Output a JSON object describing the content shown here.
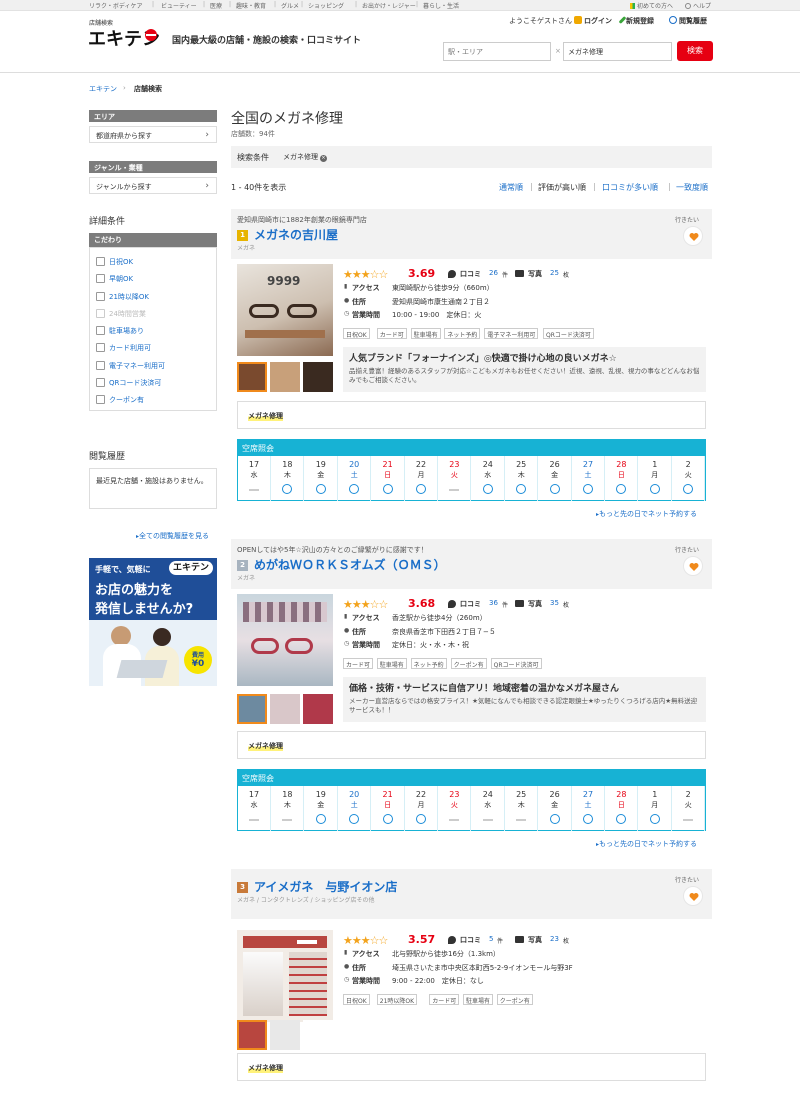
{
  "topbar": {
    "categories": [
      "リラク・ボディケア",
      "ビューティー",
      "医療",
      "趣味・教育",
      "グルメ",
      "ショッピング",
      "お出かけ・レジャー",
      "暮らし・生活"
    ],
    "first_time": "初めての方へ",
    "help": "ヘルプ"
  },
  "header": {
    "logo_caption": "店舗検索",
    "logo_text": "エキテン",
    "tagline": "国内最大級の店舗・施設の検索・口コミサイト",
    "greeting": "ようこそゲストさん",
    "login": "ログイン",
    "register": "新規登録",
    "history": "閲覧履歴",
    "area_placeholder": "駅・エリア",
    "keyword_value": "メガネ修理",
    "clear": "×",
    "search_button": "検索"
  },
  "breadcrumb": {
    "home": "エキテン",
    "sep": "›",
    "current": "店舗検索"
  },
  "sidebar": {
    "area_title": "エリア",
    "area_link": "都道府県から探す",
    "genre_title": "ジャンル・業種",
    "genre_link": "ジャンルから探す",
    "detail_title": "詳細条件",
    "kodawari_title": "こだわり",
    "conditions": [
      "日祝OK",
      "早朝OK",
      "21時以降OK",
      "24時間営業",
      "駐車場あり",
      "カード利用可",
      "電子マネー利用可",
      "QRコード決済可",
      "クーポン有"
    ],
    "history_title": "閲覧履歴",
    "history_empty": "最近見た店舗・施設はありません。",
    "history_more": "全ての閲覧履歴を見る",
    "banner": {
      "line1": "手軽で、気軽に",
      "logo": "エキテン",
      "line2": "お店の魅力を",
      "line3": "発信しませんか?",
      "fee_label": "費用",
      "fee_value": "¥0"
    }
  },
  "main": {
    "title": "全国のメガネ修理",
    "store_count": "店舗数：94件",
    "condition_label": "検索条件",
    "condition_tag": "メガネ修理",
    "range": "1 - 40件を表示",
    "sorts": [
      "通常順",
      "評価が高い順",
      "口コミが多い順",
      "一致度順"
    ],
    "sort_sep": "|",
    "want_label": "行きたい",
    "calendar_title": "空席照会",
    "calendar_more": "もっと先の日でネット予約する",
    "calendar_days": [
      {
        "d": "17",
        "w": "水"
      },
      {
        "d": "18",
        "w": "木"
      },
      {
        "d": "19",
        "w": "金"
      },
      {
        "d": "20",
        "w": "土"
      },
      {
        "d": "21",
        "w": "日"
      },
      {
        "d": "22",
        "w": "月"
      },
      {
        "d": "23",
        "w": "火"
      },
      {
        "d": "24",
        "w": "水"
      },
      {
        "d": "25",
        "w": "木"
      },
      {
        "d": "26",
        "w": "金"
      },
      {
        "d": "27",
        "w": "土"
      },
      {
        "d": "28",
        "w": "日"
      },
      {
        "d": "1",
        "w": "月"
      },
      {
        "d": "2",
        "w": "火"
      }
    ],
    "kuchikomi_label": "口コミ",
    "photo_label": "写真",
    "ken": "件",
    "mai": "枚",
    "access_label": "アクセス",
    "address_label": "住所",
    "hours_label": "営業時間",
    "stores": [
      {
        "rank": "1",
        "catch": "愛知県岡崎市に1882年創業の眼鏡専門店",
        "name": "メガネの吉川屋",
        "genre": "メガネ",
        "rating": "3.69",
        "stars": "★★★☆☆",
        "reviews": "26",
        "photos": "25",
        "access": "東岡崎駅から徒歩9分（660m）",
        "address": "愛知県岡崎市康生通南２丁目２",
        "hours": "10:00 - 19:00　定休日：火",
        "tags": [
          "日祝OK",
          "カード可",
          "駐車場有",
          "ネット予約",
          "電子マネー利用可",
          "QRコード決済可"
        ],
        "pr_title": "人気ブランド「フォーナインズ」◎快適で掛け心地の良いメガネ☆",
        "pr_text": "品揃え豊富！経験のあるスタッフが対応☆こどもメガネもお任せください！近視、遠視、乱視、視力の事などどんなお悩みでもご相談ください。",
        "keyword": "メガネ修理",
        "availability": [
          "-",
          "o",
          "o",
          "o",
          "o",
          "o",
          "-",
          "o",
          "o",
          "o",
          "o",
          "o",
          "o",
          "o"
        ]
      },
      {
        "rank": "2",
        "catch": "OPENしてはや5年☆沢山の方々とのご縁繁がりに感謝です！",
        "name": "めがねＷＯＲＫＳオムズ（ＯＭＳ）",
        "genre": "メガネ",
        "rating": "3.68",
        "stars": "★★★☆☆",
        "reviews": "36",
        "photos": "35",
        "access": "香芝駅から徒歩4分（260m）",
        "address": "奈良県香芝市下田西２丁目７−５",
        "hours": "定休日：火・水・木・祝",
        "tags": [
          "カード可",
          "駐車場有",
          "ネット予約",
          "クーポン有",
          "QRコード決済可"
        ],
        "pr_title": "価格・技術・サービスに自信アリ！地域密着の温かなメガネ屋さん",
        "pr_text": "メーカー直営店ならではの格安プライス！★気軽になんでも相談できる認定眼鏡士★ゆったりくつろげる店内★無料送迎サービスも！！",
        "keyword": "メガネ修理",
        "availability": [
          "-",
          "-",
          "o",
          "o",
          "o",
          "o",
          "-",
          "-",
          "-",
          "o",
          "o",
          "o",
          "o",
          "-"
        ]
      },
      {
        "rank": "3",
        "catch": "",
        "name": "アイメガネ　与野イオン店",
        "genre": "メガネ / コンタクトレンズ / ショッピング店その他",
        "rating": "3.57",
        "stars": "★★★☆☆",
        "reviews": "5",
        "photos": "23",
        "access": "北与野駅から徒歩16分（1.3km）",
        "address": "埼玉県さいたま市中央区本町西5-2-9イオンモール与野3F",
        "hours": "9:00 - 22:00　定休日：なし",
        "tags": [
          "日祝OK",
          "21時以降OK",
          "カード可",
          "駐車場有",
          "クーポン有"
        ],
        "keyword": "メガネ修理"
      }
    ]
  },
  "colors": {
    "accent_red": "#e60012",
    "link_blue": "#1a6ec8",
    "calendar_cyan": "#17b2d4",
    "star": "#f3a31c"
  }
}
